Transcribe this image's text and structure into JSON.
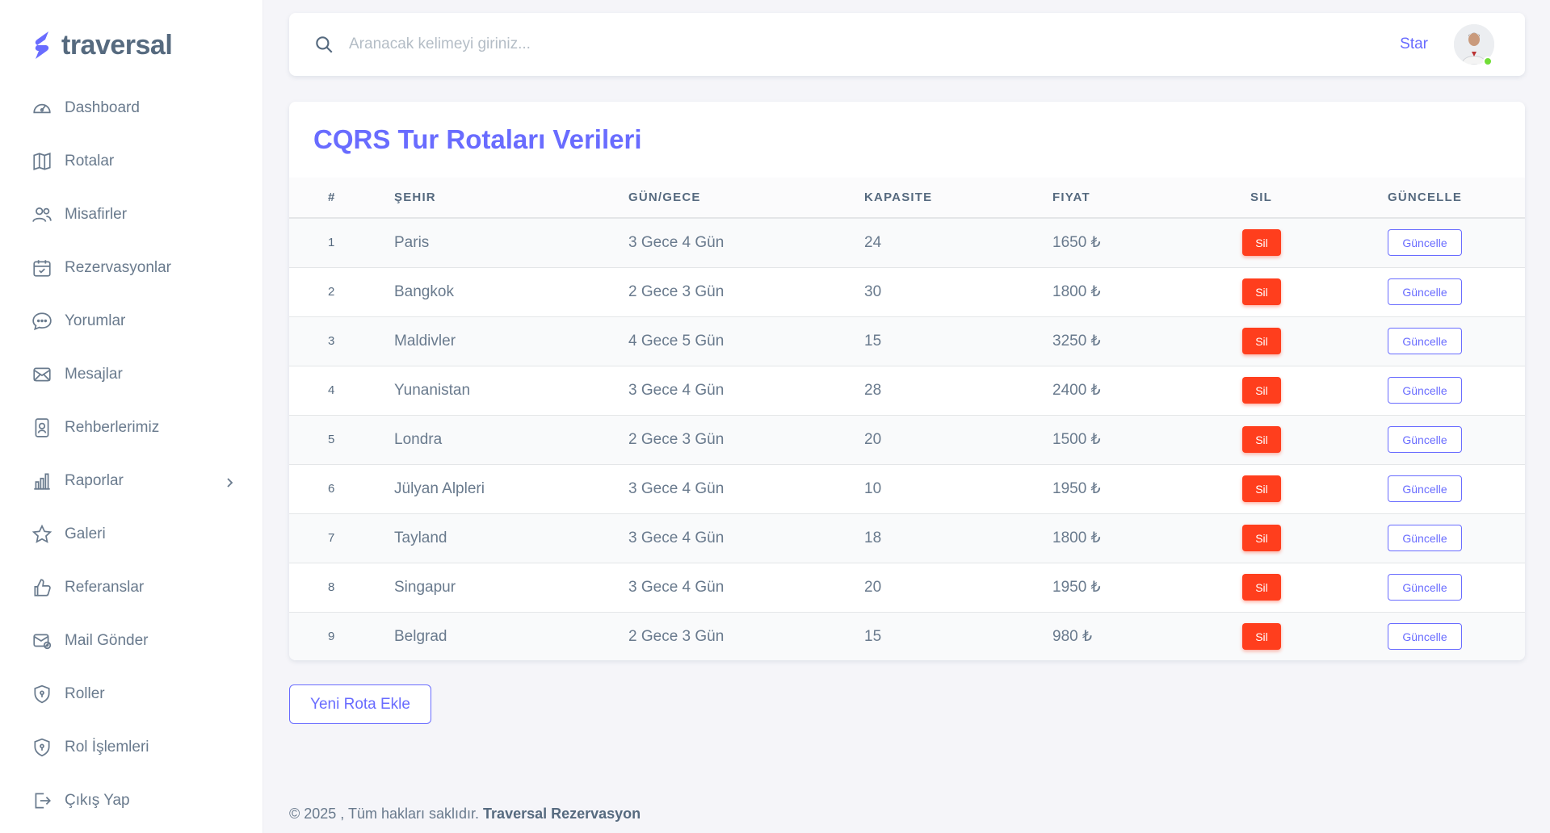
{
  "brand": {
    "name": "traversal",
    "color": "#696cff"
  },
  "sidebar": {
    "items": [
      {
        "label": "Dashboard",
        "icon": "dashboard-gauge-icon"
      },
      {
        "label": "Rotalar",
        "icon": "map-icon"
      },
      {
        "label": "Misafirler",
        "icon": "users-icon"
      },
      {
        "label": "Rezervasyonlar",
        "icon": "calendar-check-icon"
      },
      {
        "label": "Yorumlar",
        "icon": "chat-bubble-icon"
      },
      {
        "label": "Mesajlar",
        "icon": "envelope-icon"
      },
      {
        "label": "Rehberlerimiz",
        "icon": "id-badge-icon"
      },
      {
        "label": "Raporlar",
        "icon": "bar-chart-icon",
        "has_submenu": true
      },
      {
        "label": "Galeri",
        "icon": "star-icon"
      },
      {
        "label": "Referanslar",
        "icon": "thumbs-up-icon"
      },
      {
        "label": "Mail Gönder",
        "icon": "mail-send-icon"
      },
      {
        "label": "Roller",
        "icon": "shield-icon"
      },
      {
        "label": "Rol İşlemleri",
        "icon": "shield-icon"
      },
      {
        "label": "Çıkış Yap",
        "icon": "logout-icon"
      }
    ]
  },
  "navbar": {
    "search_placeholder": "Aranacak kelimeyi giriniz...",
    "star_label": "Star",
    "avatar_status_color": "#71dd37"
  },
  "card": {
    "title": "CQRS Tur Rotaları Verileri",
    "columns": [
      "#",
      "ŞEHIR",
      "GÜN/GECE",
      "KAPASITE",
      "FIYAT",
      "SIL",
      "GÜNCELLE"
    ],
    "rows": [
      {
        "idx": "1",
        "city": "Paris",
        "days": "3 Gece 4 Gün",
        "capacity": "24",
        "price": "1650 ₺"
      },
      {
        "idx": "2",
        "city": "Bangkok",
        "days": "2 Gece 3 Gün",
        "capacity": "30",
        "price": "1800 ₺"
      },
      {
        "idx": "3",
        "city": "Maldivler",
        "days": "4 Gece 5 Gün",
        "capacity": "15",
        "price": "3250 ₺"
      },
      {
        "idx": "4",
        "city": "Yunanistan",
        "days": "3 Gece 4 Gün",
        "capacity": "28",
        "price": "2400 ₺"
      },
      {
        "idx": "5",
        "city": "Londra",
        "days": "2 Gece 3 Gün",
        "capacity": "20",
        "price": "1500 ₺"
      },
      {
        "idx": "6",
        "city": "Jülyan Alpleri",
        "days": "3 Gece 4 Gün",
        "capacity": "10",
        "price": "1950 ₺"
      },
      {
        "idx": "7",
        "city": "Tayland",
        "days": "3 Gece 4 Gün",
        "capacity": "18",
        "price": "1800 ₺"
      },
      {
        "idx": "8",
        "city": "Singapur",
        "days": "3 Gece 4 Gün",
        "capacity": "20",
        "price": "1950 ₺"
      },
      {
        "idx": "9",
        "city": "Belgrad",
        "days": "2 Gece 3 Gün",
        "capacity": "15",
        "price": "980 ₺"
      }
    ],
    "delete_label": "Sil",
    "update_label": "Güncelle",
    "delete_color": "#ff3e1d",
    "update_color": "#696cff"
  },
  "new_route_button": "Yeni Rota Ekle",
  "footer": {
    "prefix": "© 2025 , Tüm hakları saklıdır. ",
    "company": "Traversal Rezervasyon"
  }
}
